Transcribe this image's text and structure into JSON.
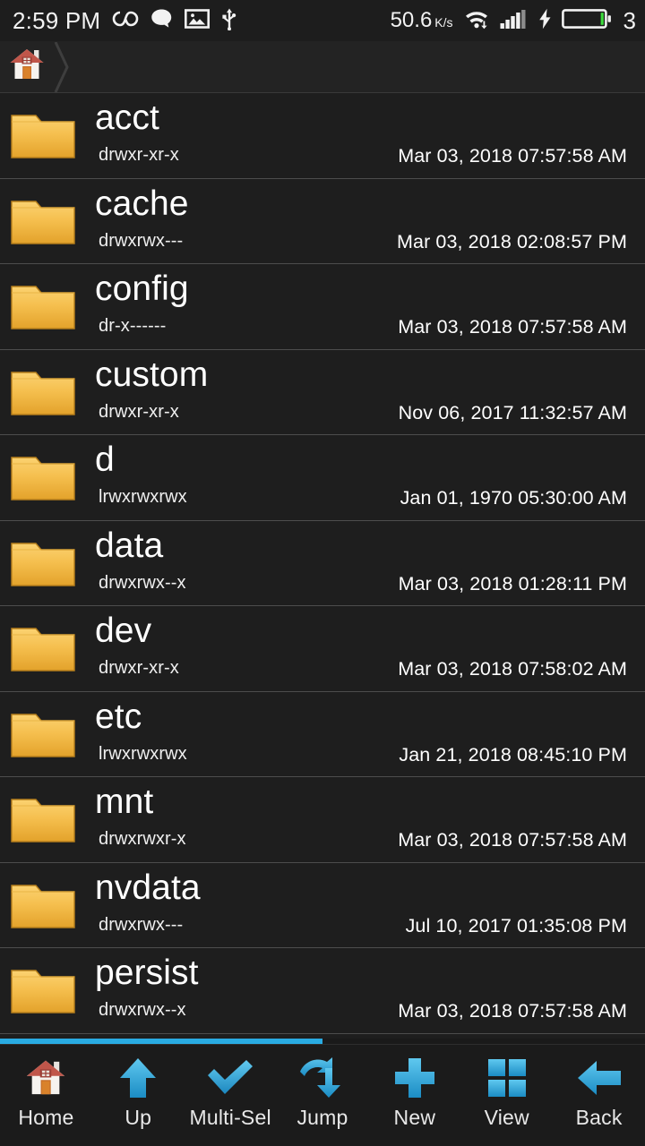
{
  "status_bar": {
    "time": "2:59 PM",
    "left_icons": [
      "infinity-icon",
      "message-bubble-icon",
      "photo-icon",
      "usb-icon"
    ],
    "network_speed": "50.6",
    "network_speed_unit": "K/s",
    "right_icons": [
      "wifi-download-icon",
      "signal-bars-icon",
      "charging-bolt-icon",
      "battery-icon"
    ],
    "battery_percent": "3"
  },
  "breadcrumb": {
    "items": [
      {
        "label": "",
        "icon": "home-house-icon"
      }
    ],
    "separator": "chevron-right"
  },
  "colors": {
    "accent": "#29abe2",
    "folder": "#f0b73c",
    "row_bg": "#1e1e1e",
    "divider": "#4d4d4d",
    "text": "#ffffff"
  },
  "file_list": {
    "columns": [
      "name",
      "permissions",
      "modified"
    ],
    "rows": [
      {
        "name": "acct",
        "permissions": "drwxr-xr-x",
        "modified": "Mar 03, 2018 07:57:58 AM",
        "icon": "folder-icon"
      },
      {
        "name": "cache",
        "permissions": "drwxrwx---",
        "modified": "Mar 03, 2018 02:08:57 PM",
        "icon": "folder-icon"
      },
      {
        "name": "config",
        "permissions": "dr-x------",
        "modified": "Mar 03, 2018 07:57:58 AM",
        "icon": "folder-icon"
      },
      {
        "name": "custom",
        "permissions": "drwxr-xr-x",
        "modified": "Nov 06, 2017 11:32:57 AM",
        "icon": "folder-icon"
      },
      {
        "name": "d",
        "permissions": "lrwxrwxrwx",
        "modified": "Jan 01, 1970 05:30:00 AM",
        "icon": "folder-icon"
      },
      {
        "name": "data",
        "permissions": "drwxrwx--x",
        "modified": "Mar 03, 2018 01:28:11 PM",
        "icon": "folder-icon"
      },
      {
        "name": "dev",
        "permissions": "drwxr-xr-x",
        "modified": "Mar 03, 2018 07:58:02 AM",
        "icon": "folder-icon"
      },
      {
        "name": "etc",
        "permissions": "lrwxrwxrwx",
        "modified": "Jan 21, 2018 08:45:10 PM",
        "icon": "folder-icon"
      },
      {
        "name": "mnt",
        "permissions": "drwxrwxr-x",
        "modified": "Mar 03, 2018 07:57:58 AM",
        "icon": "folder-icon"
      },
      {
        "name": "nvdata",
        "permissions": "drwxrwx---",
        "modified": "Jul 10, 2017 01:35:08 PM",
        "icon": "folder-icon"
      },
      {
        "name": "persist",
        "permissions": "drwxrwx--x",
        "modified": "Mar 03, 2018 07:57:58 AM",
        "icon": "folder-icon"
      }
    ]
  },
  "scrollbar": {
    "fill_percent": 50
  },
  "toolbar": {
    "items": [
      {
        "label": "Home",
        "icon": "home-house-icon"
      },
      {
        "label": "Up",
        "icon": "arrow-up-icon"
      },
      {
        "label": "Multi-Sel",
        "icon": "checkmark-icon"
      },
      {
        "label": "Jump",
        "icon": "curved-arrow-icon"
      },
      {
        "label": "New",
        "icon": "plus-icon"
      },
      {
        "label": "View",
        "icon": "grid-icon"
      },
      {
        "label": "Back",
        "icon": "arrow-left-icon"
      }
    ]
  }
}
